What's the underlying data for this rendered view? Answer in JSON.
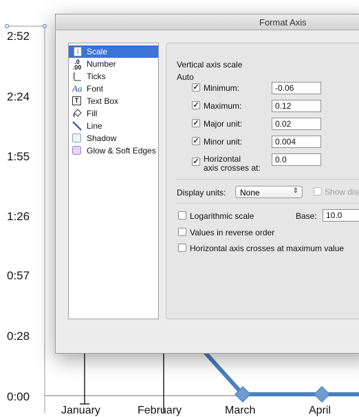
{
  "chart": {
    "y_tick_labels": [
      "2:52",
      "2:24",
      "1:55",
      "1:26",
      "0:57",
      "0:28",
      "0:00"
    ],
    "x_categories": [
      "January",
      "February",
      "March",
      "April"
    ],
    "line_color": "#4b7fbf"
  },
  "dialog": {
    "title": "Format Axis",
    "sidebar": [
      {
        "label": "Scale",
        "icon": "scale-icon",
        "selected": true
      },
      {
        "label": "Number",
        "icon": "number-icon"
      },
      {
        "label": "Ticks",
        "icon": "ticks-icon"
      },
      {
        "label": "Font",
        "icon": "font-icon"
      },
      {
        "label": "Text Box",
        "icon": "text-box-icon"
      },
      {
        "label": "Fill",
        "icon": "fill-bucket-icon"
      },
      {
        "label": "Line",
        "icon": "line-icon"
      },
      {
        "label": "Shadow",
        "icon": "shadow-icon"
      },
      {
        "label": "Glow & Soft Edges",
        "icon": "glow-icon"
      }
    ],
    "panel": {
      "heading": "Vertical axis scale",
      "auto_label": "Auto",
      "minimum": {
        "label": "Minimum:",
        "value": "-0.06",
        "checked": true
      },
      "maximum": {
        "label": "Maximum:",
        "value": "0.12",
        "checked": true
      },
      "major_unit": {
        "label": "Major unit:",
        "value": "0.02",
        "checked": true
      },
      "minor_unit": {
        "label": "Minor unit:",
        "value": "0.004",
        "checked": true
      },
      "crosses": {
        "label_line1": "Horizontal",
        "label_line2": "axis crosses at:",
        "value": "0.0",
        "checked": true
      },
      "display_units_label": "Display units:",
      "display_units_value": "None",
      "show_display_label": "Show disp",
      "logarithmic_label": "Logarithmic scale",
      "base_label": "Base:",
      "base_value": "10.0",
      "reverse_label": "Values in reverse order",
      "max_cross_label": "Horizontal axis crosses at maximum value"
    }
  }
}
